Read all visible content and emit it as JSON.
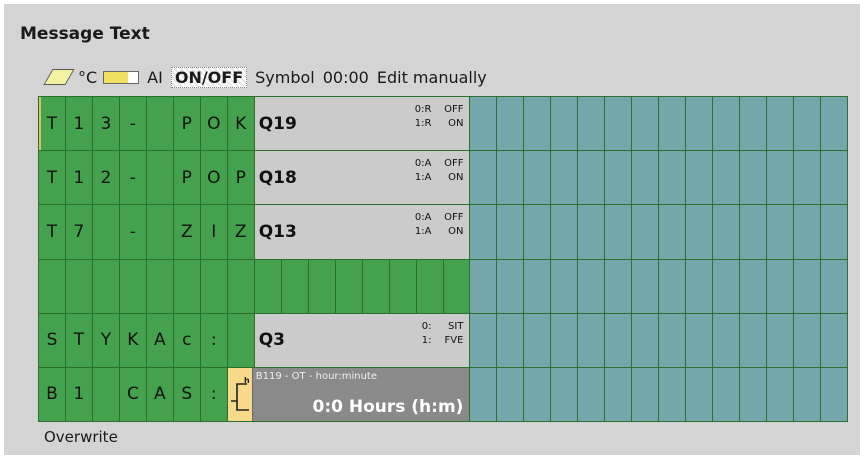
{
  "title": "Message Text",
  "toolbar": {
    "eraser_icon": "eraser-icon",
    "degrees_label": "°C",
    "bargraph_icon": "bargraph-icon",
    "ai_label": "AI",
    "onoff_label": "ON/OFF",
    "symbol_label": "Symbol",
    "time_label": "00:00",
    "edit_manually_label": "Edit manually"
  },
  "rows": [
    {
      "chars": [
        "T",
        "1",
        "3",
        "-",
        "",
        "P",
        "O",
        "K"
      ],
      "block": {
        "label": "Q19",
        "states": [
          [
            "0:R",
            "OFF"
          ],
          [
            "1:R",
            "ON"
          ]
        ]
      }
    },
    {
      "chars": [
        "T",
        "1",
        "2",
        "-",
        "",
        "P",
        "O",
        "P"
      ],
      "block": {
        "label": "Q18",
        "states": [
          [
            "0:A",
            "OFF"
          ],
          [
            "1:A",
            "ON"
          ]
        ]
      }
    },
    {
      "chars": [
        "T",
        "7",
        "",
        "-",
        "",
        "Z",
        "I",
        "Z"
      ],
      "block": {
        "label": "Q13",
        "states": [
          [
            "0:A",
            "OFF"
          ],
          [
            "1:A",
            "ON"
          ]
        ]
      }
    },
    {
      "chars": [
        "",
        "",
        "",
        "",
        "",
        "",
        "",
        ""
      ]
    },
    {
      "chars": [
        "S",
        "T",
        "Y",
        "K",
        "A",
        "c",
        ":",
        ""
      ],
      "block": {
        "label": "Q3",
        "states": [
          [
            "0:",
            "SIT"
          ],
          [
            "1:",
            "FVE"
          ]
        ]
      }
    },
    {
      "chars": [
        "B",
        "1",
        "",
        "C",
        "A",
        "S",
        ":"
      ],
      "time_block": {
        "icon": "time-function-icon",
        "caption": "B119 - OT - hour:minute",
        "value": "0:0 Hours (h:m)"
      }
    }
  ],
  "footer": {
    "overwrite_label": "Overwrite"
  },
  "colors": {
    "char_cell": "#44a24e",
    "empty_cell": "#73a7ab",
    "block": "#cbcbcb",
    "time_block": "#8a8a8a"
  }
}
